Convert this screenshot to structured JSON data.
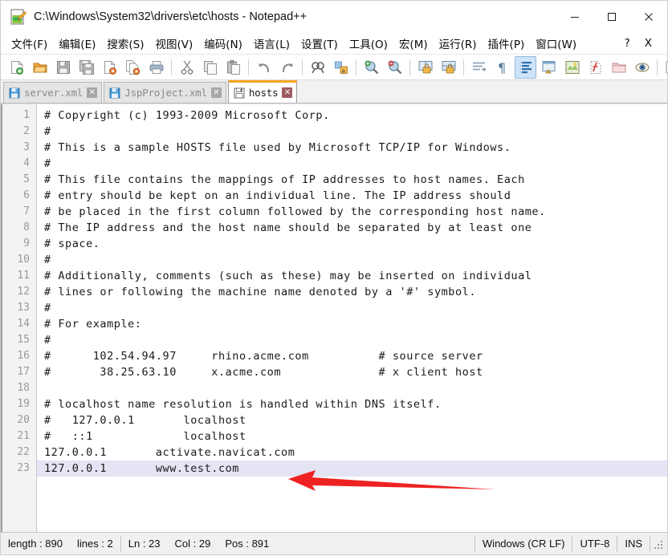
{
  "window": {
    "title": "C:\\Windows\\System32\\drivers\\etc\\hosts - Notepad++",
    "icon": "notepad-plus-plus-icon",
    "minimize_label": "—",
    "maximize_label": "☐",
    "close_label": "✕"
  },
  "menu": {
    "items": [
      {
        "label": "文件(F)",
        "name": "menu-file"
      },
      {
        "label": "编辑(E)",
        "name": "menu-edit"
      },
      {
        "label": "搜索(S)",
        "name": "menu-search"
      },
      {
        "label": "视图(V)",
        "name": "menu-view"
      },
      {
        "label": "编码(N)",
        "name": "menu-encoding"
      },
      {
        "label": "语言(L)",
        "name": "menu-language"
      },
      {
        "label": "设置(T)",
        "name": "menu-settings"
      },
      {
        "label": "工具(O)",
        "name": "menu-tools"
      },
      {
        "label": "宏(M)",
        "name": "menu-macro"
      },
      {
        "label": "运行(R)",
        "name": "menu-run"
      },
      {
        "label": "插件(P)",
        "name": "menu-plugins"
      },
      {
        "label": "窗口(W)",
        "name": "menu-window"
      }
    ],
    "help_label": "?",
    "close_doc_label": "X"
  },
  "toolbar": {
    "overflow_label": "»",
    "buttons": [
      {
        "name": "new-file-icon"
      },
      {
        "name": "open-file-icon"
      },
      {
        "name": "save-icon"
      },
      {
        "name": "save-all-icon"
      },
      {
        "name": "close-file-icon"
      },
      {
        "name": "close-all-icon"
      },
      {
        "name": "print-icon"
      },
      {
        "name": "separator"
      },
      {
        "name": "cut-icon"
      },
      {
        "name": "copy-icon"
      },
      {
        "name": "paste-icon"
      },
      {
        "name": "separator"
      },
      {
        "name": "undo-icon"
      },
      {
        "name": "redo-icon"
      },
      {
        "name": "separator"
      },
      {
        "name": "find-icon"
      },
      {
        "name": "replace-icon"
      },
      {
        "name": "separator"
      },
      {
        "name": "zoom-in-icon"
      },
      {
        "name": "zoom-out-icon"
      },
      {
        "name": "separator"
      },
      {
        "name": "sync-vertical-scroll-icon"
      },
      {
        "name": "sync-horizontal-scroll-icon"
      },
      {
        "name": "word-wrap-icon"
      },
      {
        "name": "show-all-characters-icon"
      },
      {
        "name": "indent-guide-icon"
      },
      {
        "name": "user-defined-dialog-icon"
      },
      {
        "name": "show-document-map-icon"
      },
      {
        "name": "function-list-icon"
      },
      {
        "name": "folder-as-workspace-icon"
      },
      {
        "name": "monitoring-icon"
      },
      {
        "name": "separator"
      },
      {
        "name": "record-macro-icon"
      }
    ]
  },
  "tabs": [
    {
      "label": "server.xml",
      "active": false,
      "icon": "saved-file-icon",
      "close_label": "✕"
    },
    {
      "label": "JspProject.xml",
      "active": false,
      "icon": "saved-file-icon",
      "close_label": "✕"
    },
    {
      "label": "hosts",
      "active": true,
      "icon": "saved-file-icon",
      "close_label": "✕"
    }
  ],
  "editor": {
    "current_line": 23,
    "lines": [
      {
        "n": 1,
        "text": "# Copyright (c) 1993-2009 Microsoft Corp."
      },
      {
        "n": 2,
        "text": "#"
      },
      {
        "n": 3,
        "text": "# This is a sample HOSTS file used by Microsoft TCP/IP for Windows."
      },
      {
        "n": 4,
        "text": "#"
      },
      {
        "n": 5,
        "text": "# This file contains the mappings of IP addresses to host names. Each"
      },
      {
        "n": 6,
        "text": "# entry should be kept on an individual line. The IP address should"
      },
      {
        "n": 7,
        "text": "# be placed in the first column followed by the corresponding host name."
      },
      {
        "n": 8,
        "text": "# The IP address and the host name should be separated by at least one"
      },
      {
        "n": 9,
        "text": "# space."
      },
      {
        "n": 10,
        "text": "#"
      },
      {
        "n": 11,
        "text": "# Additionally, comments (such as these) may be inserted on individual"
      },
      {
        "n": 12,
        "text": "# lines or following the machine name denoted by a '#' symbol."
      },
      {
        "n": 13,
        "text": "#"
      },
      {
        "n": 14,
        "text": "# For example:"
      },
      {
        "n": 15,
        "text": "#"
      },
      {
        "n": 16,
        "text": "#      102.54.94.97     rhino.acme.com          # source server"
      },
      {
        "n": 17,
        "text": "#       38.25.63.10     x.acme.com              # x client host"
      },
      {
        "n": 18,
        "text": ""
      },
      {
        "n": 19,
        "text": "# localhost name resolution is handled within DNS itself."
      },
      {
        "n": 20,
        "text": "#   127.0.0.1       localhost"
      },
      {
        "n": 21,
        "text": "#   ::1             localhost"
      },
      {
        "n": 22,
        "text": "127.0.0.1       activate.navicat.com"
      },
      {
        "n": 23,
        "text": "127.0.0.1       www.test.com"
      }
    ]
  },
  "annotation": {
    "type": "red-arrow",
    "color": "#ee2222",
    "direction": "left",
    "points_to_line": 23
  },
  "statusbar": {
    "length_label": "length : 890",
    "lines_label": "lines : 2",
    "ln_label": "Ln : 23",
    "col_label": "Col : 29",
    "pos_label": "Pos : 891",
    "eol_label": "Windows (CR LF)",
    "encoding_label": "UTF-8",
    "insert_mode_label": "INS"
  },
  "colors": {
    "accent_orange": "#f5a623",
    "current_line_highlight": "#e4e4f4",
    "annotation_red": "#ee2222"
  }
}
